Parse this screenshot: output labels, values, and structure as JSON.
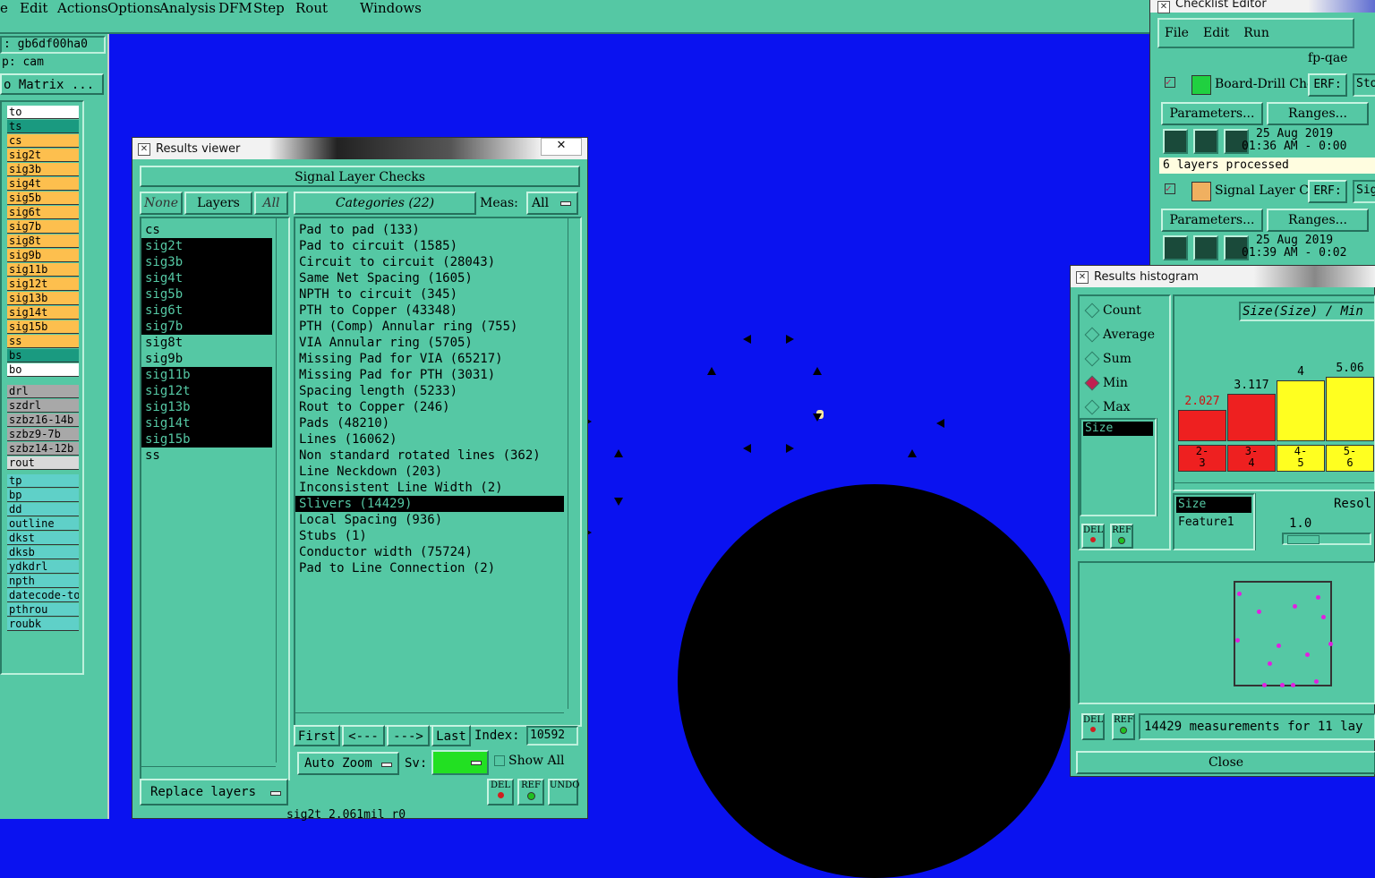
{
  "menubar": {
    "items": [
      "e",
      "Edit",
      "Actions",
      "Options",
      "Analysis",
      "DFM",
      "Step",
      "Rout",
      "Windows"
    ]
  },
  "left_panel": {
    "job_label": ": gb6df00ha0",
    "step_label": "p: cam",
    "matrix_button": "o Matrix ...",
    "layers_board": [
      {
        "name": "to",
        "color": "#ffffff"
      },
      {
        "name": "ts",
        "color": "#1a9a80"
      },
      {
        "name": "cs",
        "color": "#fdbf4e"
      },
      {
        "name": "sig2t",
        "color": "#fdbf4e"
      },
      {
        "name": "sig3b",
        "color": "#fdbf4e"
      },
      {
        "name": "sig4t",
        "color": "#fdbf4e"
      },
      {
        "name": "sig5b",
        "color": "#fdbf4e"
      },
      {
        "name": "sig6t",
        "color": "#fdbf4e"
      },
      {
        "name": "sig7b",
        "color": "#fdbf4e"
      },
      {
        "name": "sig8t",
        "color": "#fdbf4e"
      },
      {
        "name": "sig9b",
        "color": "#fdbf4e"
      },
      {
        "name": "sig11b",
        "color": "#fdbf4e"
      },
      {
        "name": "sig12t",
        "color": "#fdbf4e"
      },
      {
        "name": "sig13b",
        "color": "#fdbf4e"
      },
      {
        "name": "sig14t",
        "color": "#fdbf4e"
      },
      {
        "name": "sig15b",
        "color": "#fdbf4e"
      },
      {
        "name": "ss",
        "color": "#fdbf4e"
      },
      {
        "name": "bs",
        "color": "#1a9a80"
      },
      {
        "name": "bo",
        "color": "#ffffff"
      }
    ],
    "layers_drill": [
      "drl",
      "szdrl",
      "szbz16-14b",
      "szbz9-7b",
      "szbz14-12b",
      "rout"
    ],
    "layers_misc": [
      "tp",
      "bp",
      "dd",
      "outline",
      "dkst",
      "dksb",
      "ydkdrl",
      "npth",
      "datecode-to",
      "pthrou",
      "roubk"
    ]
  },
  "results_viewer": {
    "title": "Results viewer",
    "header": "Signal Layer Checks",
    "none_btn": "None",
    "layers_btn": "Layers",
    "all_btn": "All",
    "categories_btn": "Categories (22)",
    "meas_label": "Meas:",
    "meas_value": "All",
    "layers": [
      {
        "name": "cs",
        "selected": false
      },
      {
        "name": "sig2t",
        "selected": true
      },
      {
        "name": "sig3b",
        "selected": true
      },
      {
        "name": "sig4t",
        "selected": true
      },
      {
        "name": "sig5b",
        "selected": true
      },
      {
        "name": "sig6t",
        "selected": true
      },
      {
        "name": "sig7b",
        "selected": true
      },
      {
        "name": "sig8t",
        "selected": false
      },
      {
        "name": "sig9b",
        "selected": false
      },
      {
        "name": "sig11b",
        "selected": true
      },
      {
        "name": "sig12t",
        "selected": true
      },
      {
        "name": "sig13b",
        "selected": true
      },
      {
        "name": "sig14t",
        "selected": true
      },
      {
        "name": "sig15b",
        "selected": true
      },
      {
        "name": "ss",
        "selected": false
      }
    ],
    "categories": [
      {
        "name": "Pad to pad (133)",
        "selected": false
      },
      {
        "name": "Pad to circuit (1585)",
        "selected": false
      },
      {
        "name": "Circuit to circuit (28043)",
        "selected": false
      },
      {
        "name": "Same Net Spacing (1605)",
        "selected": false
      },
      {
        "name": "NPTH to circuit (345)",
        "selected": false
      },
      {
        "name": "PTH to Copper (43348)",
        "selected": false
      },
      {
        "name": "PTH (Comp) Annular ring (755)",
        "selected": false
      },
      {
        "name": "VIA Annular ring (5705)",
        "selected": false
      },
      {
        "name": "Missing Pad for VIA (65217)",
        "selected": false
      },
      {
        "name": "Missing Pad for PTH (3031)",
        "selected": false
      },
      {
        "name": "Spacing length (5233)",
        "selected": false
      },
      {
        "name": "Rout to Copper (246)",
        "selected": false
      },
      {
        "name": "Pads (48210)",
        "selected": false
      },
      {
        "name": "Lines (16062)",
        "selected": false
      },
      {
        "name": "Non standard rotated lines (362)",
        "selected": false
      },
      {
        "name": "Line Neckdown (203)",
        "selected": false
      },
      {
        "name": "Inconsistent Line Width (2)",
        "selected": false
      },
      {
        "name": "Slivers (14429)",
        "selected": true
      },
      {
        "name": "Local Spacing (936)",
        "selected": false
      },
      {
        "name": "Stubs (1)",
        "selected": false
      },
      {
        "name": "Conductor width (75724)",
        "selected": false
      },
      {
        "name": "Pad to Line Connection (2)",
        "selected": false
      }
    ],
    "first_btn": "First",
    "prev_btn": "<---",
    "next_btn": "--->",
    "last_btn": "Last",
    "index_label": "Index:",
    "index_value": "10592",
    "auto_zoom": "Auto Zoom",
    "sv_label": "Sv:",
    "show_all": "Show All",
    "replace_layers": "Replace layers",
    "del": "DEL",
    "ref": "REF",
    "undo": "UNDO",
    "status": "sig2t 2.061mil  r0"
  },
  "checklist_editor": {
    "title": "Checklist Editor",
    "menu": [
      "File",
      "Edit",
      "Run"
    ],
    "checklist_name": "fp-qae",
    "checks": [
      {
        "name": "Board-Drill Che",
        "erf": "ERF:",
        "params": "Parameters...",
        "ranges": "Ranges...",
        "date": "25 Aug 2019",
        "time": "01:36 AM - 0:00",
        "stub": "Sto"
      },
      {
        "name": "Signal Layer Ch",
        "erf": "ERF:",
        "params": "Parameters...",
        "ranges": "Ranges...",
        "date": "25 Aug 2019",
        "time": "01:39 AM - 0:02",
        "stub": "Sig"
      }
    ],
    "processed": "6 layers processed"
  },
  "histogram": {
    "title": "Results histogram",
    "options": [
      {
        "label": "Count",
        "on": false
      },
      {
        "label": "Average",
        "on": false
      },
      {
        "label": "Sum",
        "on": false
      },
      {
        "label": "Min",
        "on": true
      },
      {
        "label": "Max",
        "on": false
      }
    ],
    "size_item": "Size",
    "chart_title": "Size(Size) / Min",
    "bars": [
      {
        "value": "2.027",
        "range": "2-\n3",
        "color": "#ee2020",
        "level": 0.48
      },
      {
        "value": "3.117",
        "range": "3-\n4",
        "color": "#ee2020",
        "level": 0.74
      },
      {
        "value": "4",
        "range": "4-\n5",
        "color": "#ffff20",
        "level": 0.94
      },
      {
        "value": "5.06",
        "range": "5-\n6",
        "color": "#ffff20",
        "level": 1.0
      }
    ],
    "list_items": [
      "Size",
      "Feature1"
    ],
    "resol_label": "Resol",
    "resol_value": "1.0",
    "measurements": "14429 measurements for 11 lay",
    "close": "Close",
    "del": "DEL",
    "ref": "REF"
  }
}
